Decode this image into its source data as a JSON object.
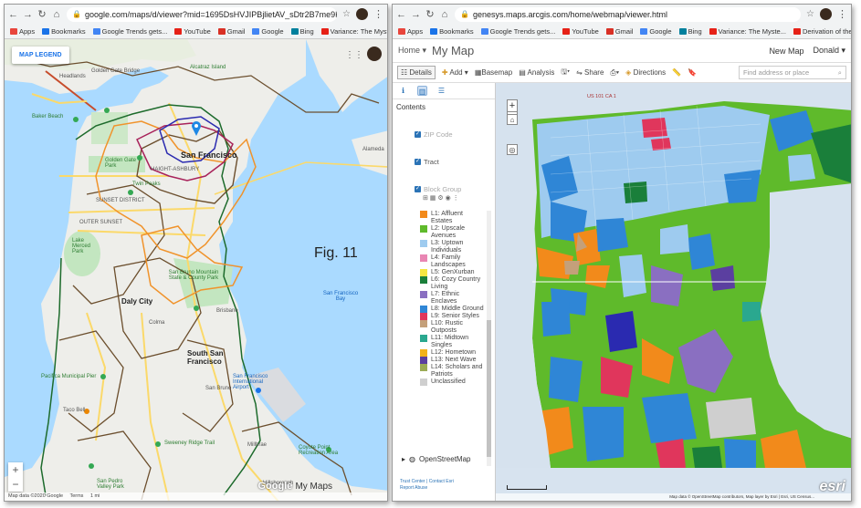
{
  "left_browser": {
    "url": "google.com/maps/d/viewer?mid=1695DsHVJIPBjlietAV_sDtr2B7me9Kf&ll=37.7042148868...",
    "bookmarks": [
      {
        "label": "Apps",
        "color": "#e8453c"
      },
      {
        "label": "Bookmarks",
        "color": "#1a73e8"
      },
      {
        "label": "Google Trends gets...",
        "color": "#4285f4"
      },
      {
        "label": "YouTube",
        "color": "#e62117"
      },
      {
        "label": "Gmail",
        "color": "#d93025"
      },
      {
        "label": "Google",
        "color": "#4285f4"
      },
      {
        "label": "Bing",
        "color": "#00809d"
      },
      {
        "label": "Variance: The Myste...",
        "color": "#e62117"
      }
    ],
    "map": {
      "legend_button": "MAP LEGEND",
      "zoom_in": "+",
      "zoom_out": "−",
      "logo_google": "Google",
      "logo_product": "My Maps",
      "footer": [
        "Map data ©2020 Google",
        "Terms",
        "1 mi"
      ],
      "labels": {
        "headlands": "Headlands",
        "golden_gate_bridge": "Golden Gate Bridge",
        "alcatraz": "Alcatraz Island",
        "baker_beach": "Baker Beach",
        "san_francisco": "San Francisco",
        "golden_gate_park": "Golden Gate Park",
        "haight_ashbury": "HAIGHT-ASHBURY",
        "twin_peaks": "Twin Peaks",
        "sunset_district": "SUNSET DISTRICT",
        "outer_sunset": "OUTER SUNSET",
        "lake_merced": "Lake Merced Park",
        "sf_bay": "San Francisco Bay",
        "alameda": "Alameda",
        "san_bruno_mountain": "San Bruno Mountain State & County Park",
        "daly_city": "Daly City",
        "colma": "Colma",
        "brisbane": "Brisbane",
        "south_sf": "South San Francisco",
        "pacifica_pier": "Pacifica Municipal Pier",
        "sf_airport": "San Francisco International Airport",
        "san_bruno": "San Bruno",
        "sweeney": "Sweeney Ridge Trail",
        "taco_bell": "Taco Bell",
        "millbrae": "Millbrae",
        "coyote_point": "Coyote Point Recreation Area",
        "san_pedro": "San Pedro Valley Park",
        "hillsborough": "Hillsborough"
      }
    },
    "figure_label": "Fig. 11"
  },
  "right_browser": {
    "url": "genesys.maps.arcgis.com/home/webmap/viewer.html",
    "bookmarks": [
      {
        "label": "Apps",
        "color": "#e8453c"
      },
      {
        "label": "Bookmarks",
        "color": "#1a73e8"
      },
      {
        "label": "Google Trends gets...",
        "color": "#4285f4"
      },
      {
        "label": "YouTube",
        "color": "#e62117"
      },
      {
        "label": "Gmail",
        "color": "#d93025"
      },
      {
        "label": "Google",
        "color": "#4285f4"
      },
      {
        "label": "Bing",
        "color": "#00809d"
      },
      {
        "label": "Variance: The Myste...",
        "color": "#e62117"
      },
      {
        "label": "Derivation of the N...",
        "color": "#e62117"
      }
    ],
    "header": {
      "home": "Home ▾",
      "title": "My Map",
      "new_map": "New Map",
      "user": "Donald ▾"
    },
    "toolbar": {
      "details": "Details",
      "add": "Add ▾",
      "basemap": "Basemap",
      "analysis": "Analysis",
      "share": "Share",
      "directions": "Directions",
      "search_placeholder": "Find address or place"
    },
    "pane": {
      "contents_title": "Contents",
      "layers": [
        "ZIP Code",
        "Tract",
        "Block Group"
      ],
      "legend": [
        {
          "label": "L1: Affluent Estates",
          "color": "#f28a1b"
        },
        {
          "label": "L2: Upscale Avenues",
          "color": "#5fba2b"
        },
        {
          "label": "L3: Uptown Individuals",
          "color": "#9ecbef"
        },
        {
          "label": "L4: Family Landscapes",
          "color": "#e986b3"
        },
        {
          "label": "L5: GenXurban",
          "color": "#f5e642"
        },
        {
          "label": "L6: Cozy Country Living",
          "color": "#1a7f3a"
        },
        {
          "label": "L7: Ethnic Enclaves",
          "color": "#8a6fc1"
        },
        {
          "label": "L8: Middle Ground",
          "color": "#2f86d6"
        },
        {
          "label": "L9: Senior Styles",
          "color": "#e0365c"
        },
        {
          "label": "L10: Rustic Outposts",
          "color": "#c4a07a"
        },
        {
          "label": "L11: Midtown Singles",
          "color": "#2aa88f"
        },
        {
          "label": "L12: Hometown",
          "color": "#f2b21b"
        },
        {
          "label": "L13: Next Wave",
          "color": "#5b3fa0"
        },
        {
          "label": "L14: Scholars and Patriots",
          "color": "#9bab55"
        },
        {
          "label": "Unclassified",
          "color": "#cfcfcf"
        }
      ],
      "basemap_layer": "OpenStreetMap",
      "footer_links": [
        "Trust Center",
        "Contact Esri",
        "Report Abuse"
      ]
    },
    "map": {
      "zoom_in": "+",
      "zoom_out": "−",
      "esri_logo": "esri",
      "attribution": "Map data © OpenStreetMap contributors, Map layer by Esri | Esri, US Census...",
      "highway_label": "US 101 CA 1"
    }
  }
}
